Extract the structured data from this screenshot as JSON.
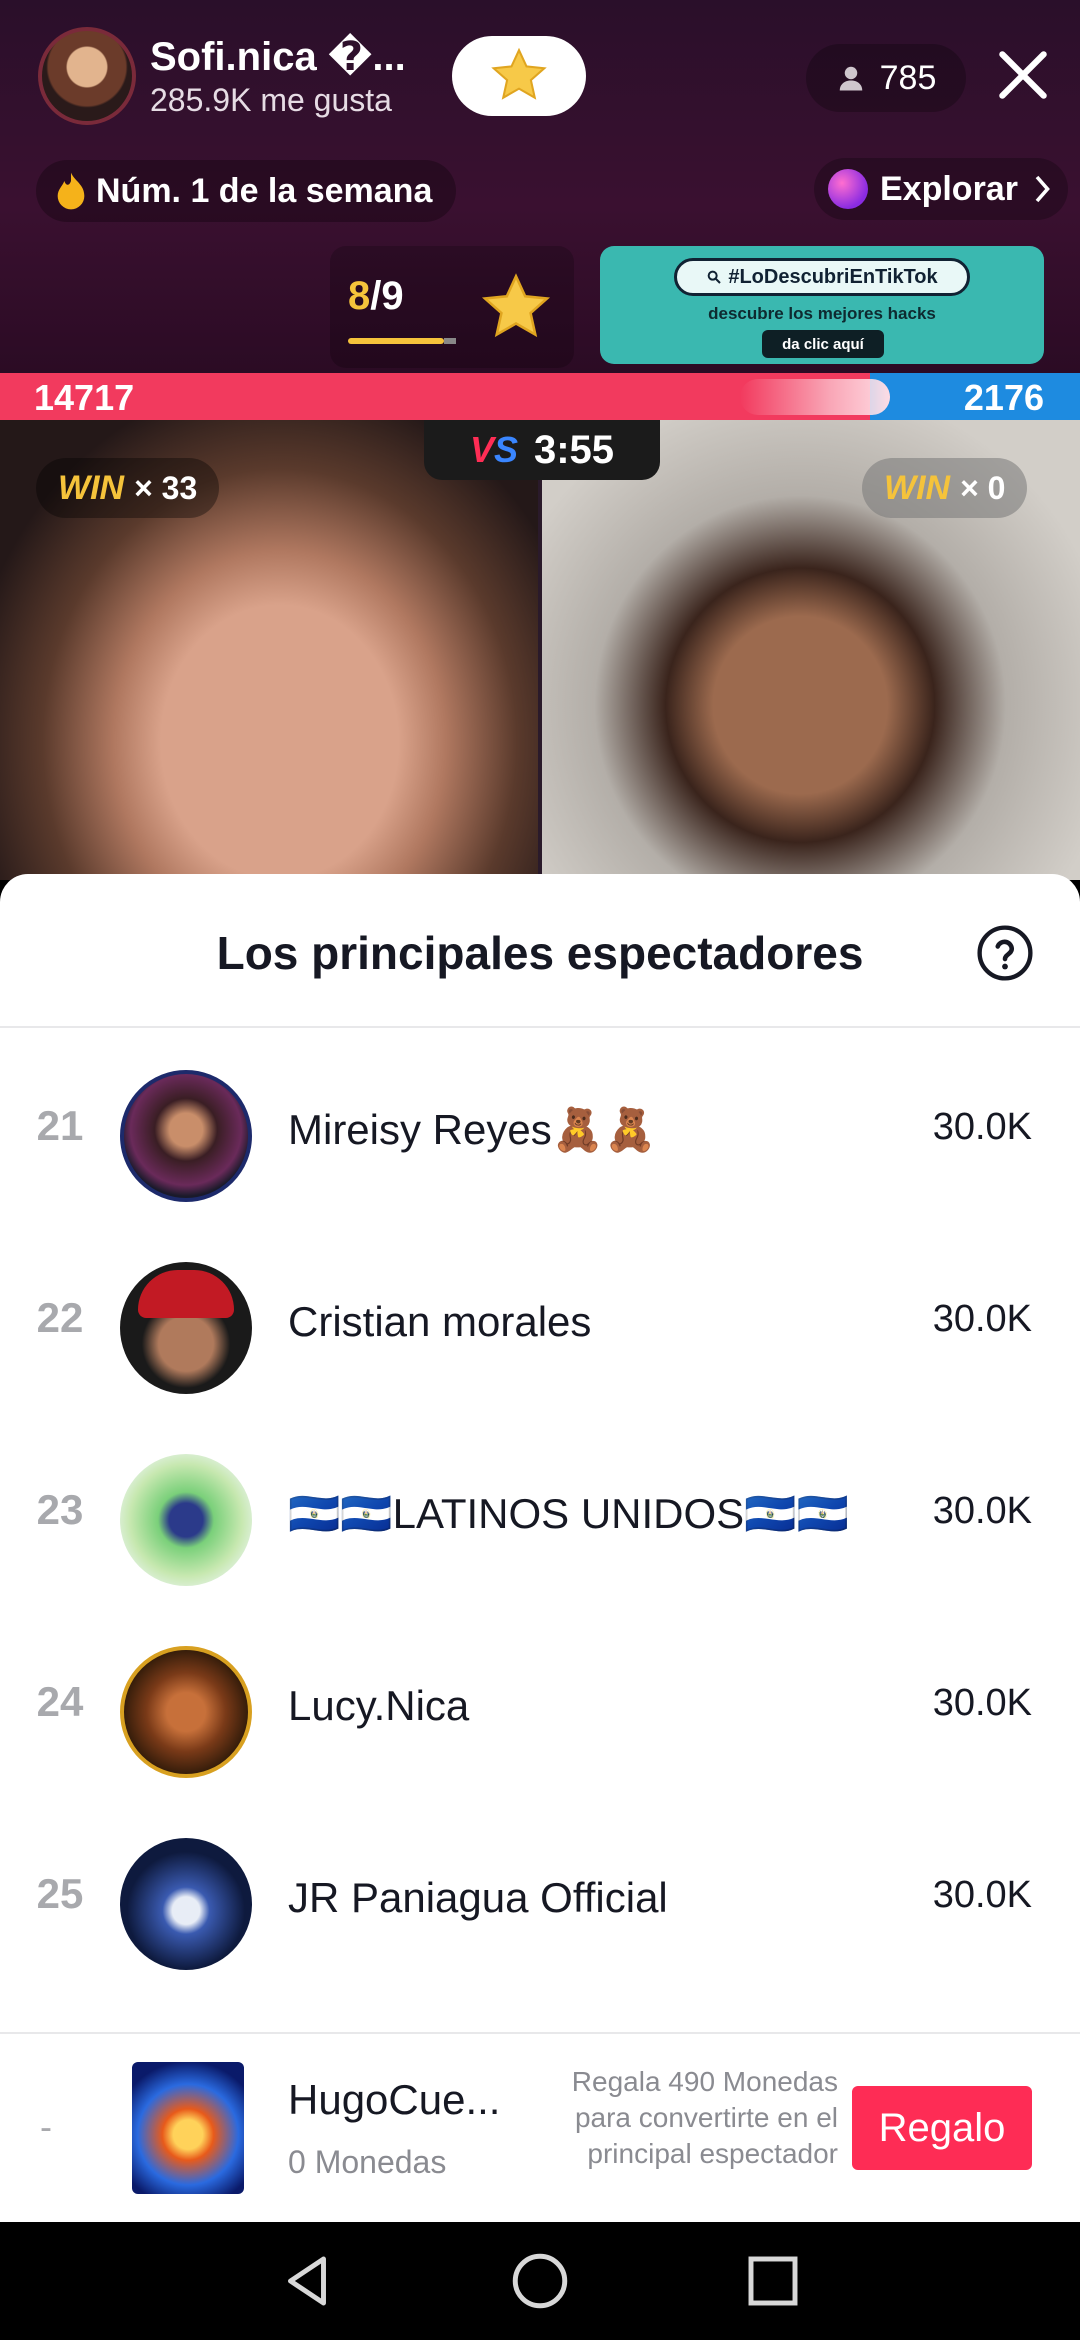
{
  "host": {
    "name": "Sofi.nica �...",
    "likes": "285.9K me gusta"
  },
  "viewers": {
    "count": "785"
  },
  "badges": {
    "rank": "Núm. 1 de la semana",
    "explore": "Explorar"
  },
  "pager": {
    "current": "8",
    "separator": "/",
    "total": "9"
  },
  "promo": {
    "hashtag": "#LoDescubriEnTikTok",
    "subtitle": "descubre los mejores hacks",
    "cta": "da clic aquí"
  },
  "battle": {
    "score_left": "14717",
    "score_right": "2176",
    "vs_label_v": "V",
    "vs_label_s": "S",
    "timer": "3:55",
    "win_label": "WIN",
    "win_left": "× 33",
    "win_right": "× 0"
  },
  "sheet": {
    "title": "Los principales espectadores",
    "rows": [
      {
        "rank": "21",
        "name": "Mireisy Reyes🧸🧸",
        "score": "30.0K"
      },
      {
        "rank": "22",
        "name": "Cristian morales",
        "score": "30.0K"
      },
      {
        "rank": "23",
        "name": "🇸🇻🇸🇻LATINOS UNIDOS🇸🇻🇸🇻",
        "score": "30.0K"
      },
      {
        "rank": "24",
        "name": "Lucy.Nica",
        "score": "30.0K"
      },
      {
        "rank": "25",
        "name": "JR Paniagua Official",
        "score": "30.0K"
      }
    ],
    "footer": {
      "rank": "-",
      "name": "HugoCue...",
      "coins": "0 Monedas",
      "note": "Regala 490 Monedas para convertirte en el principal espectador",
      "gift_button": "Regalo"
    }
  },
  "colors": {
    "accent_red": "#fe2c55",
    "score_red": "#f23a5e",
    "score_blue": "#1e8be0",
    "gold": "#f5c33b"
  }
}
